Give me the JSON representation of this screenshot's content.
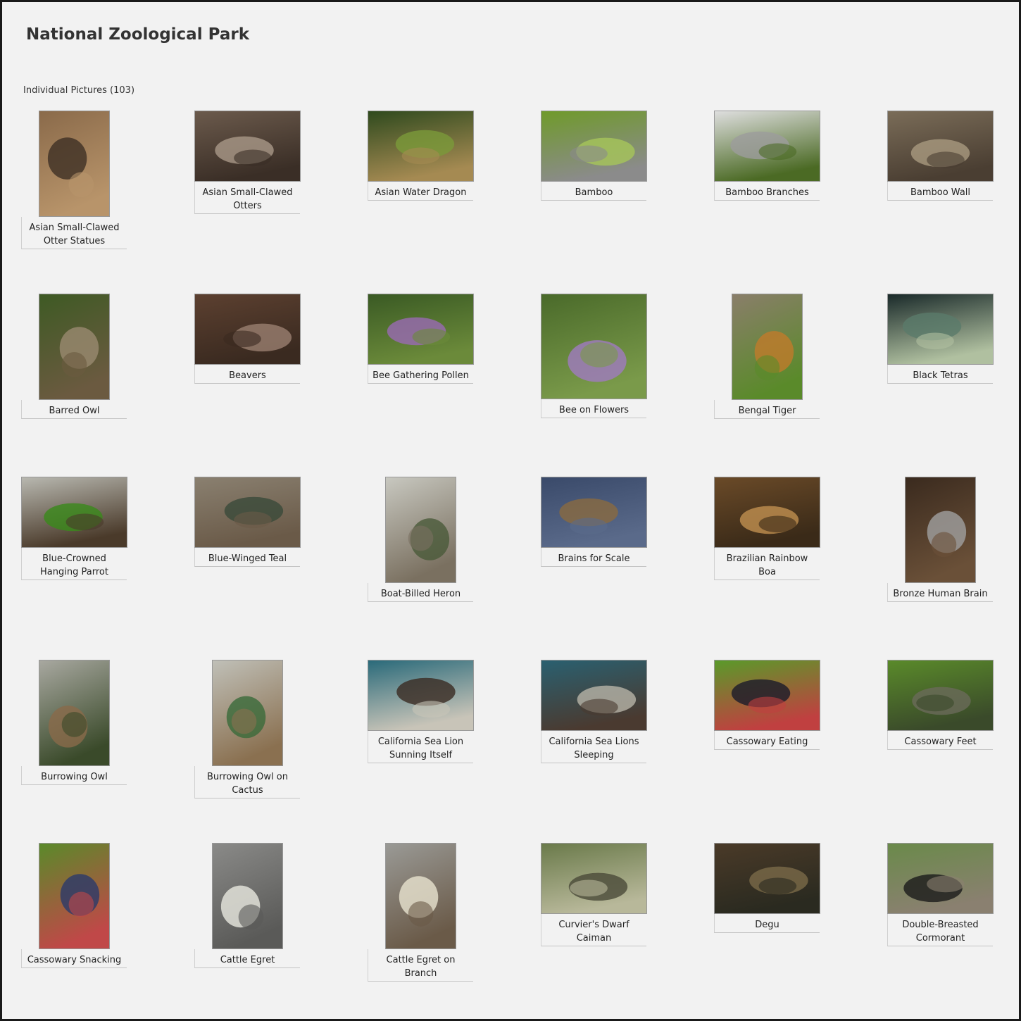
{
  "page": {
    "title": "National Zoological Park"
  },
  "section": {
    "label": "Individual Pictures (103)"
  },
  "photos": [
    {
      "caption": "Asian Small-Clawed Otter Statues",
      "orientation": "portrait",
      "palette": [
        "#8a6a4a",
        "#3d2f24",
        "#b8946a"
      ]
    },
    {
      "caption": "Asian Small-Clawed Otters",
      "orientation": "landscape",
      "palette": [
        "#6b5a4c",
        "#a99888",
        "#3a2e26"
      ]
    },
    {
      "caption": "Asian Water Dragon",
      "orientation": "landscape",
      "palette": [
        "#2f4a1e",
        "#7a9a3a",
        "#a58a52"
      ]
    },
    {
      "caption": "Bamboo",
      "orientation": "landscape",
      "palette": [
        "#6f9a2a",
        "#a6c65a",
        "#8b8b8b"
      ]
    },
    {
      "caption": "Bamboo Branches",
      "orientation": "landscape",
      "palette": [
        "#dedede",
        "#9c9c9c",
        "#4b6a24"
      ]
    },
    {
      "caption": "Bamboo Wall",
      "orientation": "landscape",
      "palette": [
        "#7a6c58",
        "#a99a80",
        "#4a3e32"
      ]
    },
    {
      "caption": "Barred Owl",
      "orientation": "portrait",
      "palette": [
        "#3e5a24",
        "#9a8a70",
        "#6b5a40"
      ]
    },
    {
      "caption": "Beavers",
      "orientation": "landscape",
      "palette": [
        "#5c4030",
        "#9a8070",
        "#3a2a20"
      ]
    },
    {
      "caption": "Bee Gathering Pollen",
      "orientation": "landscape",
      "palette": [
        "#3a5a24",
        "#9a6ab4",
        "#6b8a3a"
      ]
    },
    {
      "caption": "Bee on Flowers",
      "orientation": "portrait-wide",
      "palette": [
        "#4a6a2a",
        "#a07ac0",
        "#7a9a4a"
      ]
    },
    {
      "caption": "Bengal Tiger",
      "orientation": "portrait",
      "palette": [
        "#8a7e6a",
        "#c07a2a",
        "#5a8a2a"
      ]
    },
    {
      "caption": "Black Tetras",
      "orientation": "landscape",
      "palette": [
        "#1a2a2a",
        "#5a7a6a",
        "#b0c0a0"
      ]
    },
    {
      "caption": "Blue-Crowned Hanging Parrot",
      "orientation": "landscape",
      "palette": [
        "#b8b8b0",
        "#3a8a1a",
        "#4a3a2a"
      ]
    },
    {
      "caption": "Blue-Winged Teal",
      "orientation": "landscape",
      "palette": [
        "#8a8070",
        "#3a4a3a",
        "#6a5a48"
      ]
    },
    {
      "caption": "Boat-Billed Heron",
      "orientation": "portrait",
      "palette": [
        "#c8c8c0",
        "#4a5a3a",
        "#7a7060"
      ]
    },
    {
      "caption": "Brains for Scale",
      "orientation": "landscape",
      "palette": [
        "#3a4a6a",
        "#8a6a40",
        "#5a6a8a"
      ]
    },
    {
      "caption": "Brazilian Rainbow Boa",
      "orientation": "landscape",
      "palette": [
        "#6a4a28",
        "#c09050",
        "#3a2a18"
      ]
    },
    {
      "caption": "Bronze Human Brain",
      "orientation": "portrait",
      "palette": [
        "#3a2a1e",
        "#a0a0a0",
        "#6a5038"
      ]
    },
    {
      "caption": "Burrowing Owl",
      "orientation": "portrait",
      "palette": [
        "#a8a8a0",
        "#8a6a4a",
        "#3a4a2a"
      ]
    },
    {
      "caption": "Burrowing Owl on Cactus",
      "orientation": "portrait",
      "palette": [
        "#c0c0b8",
        "#3a6a3a",
        "#8a7050"
      ]
    },
    {
      "caption": "California Sea Lion Sunning Itself",
      "orientation": "landscape",
      "palette": [
        "#2a6a7a",
        "#3a2a22",
        "#c8c4b8"
      ]
    },
    {
      "caption": "California Sea Lions Sleeping",
      "orientation": "landscape",
      "palette": [
        "#2a6070",
        "#b8b4a8",
        "#4a3a30"
      ]
    },
    {
      "caption": "Cassowary Eating",
      "orientation": "landscape",
      "palette": [
        "#5a9a2a",
        "#1a1a2a",
        "#c04040"
      ]
    },
    {
      "caption": "Cassowary Feet",
      "orientation": "landscape",
      "palette": [
        "#5a8a2a",
        "#6a6a5a",
        "#3a4a2a"
      ]
    },
    {
      "caption": "Cassowary Snacking",
      "orientation": "portrait",
      "palette": [
        "#5a8a2a",
        "#2a3a6a",
        "#c04848"
      ]
    },
    {
      "caption": "Cattle Egret",
      "orientation": "portrait",
      "palette": [
        "#8a8a88",
        "#e8e8e0",
        "#5a5a58"
      ]
    },
    {
      "caption": "Cattle Egret on Branch",
      "orientation": "portrait",
      "palette": [
        "#9a9a96",
        "#e8e4d0",
        "#6a5a48"
      ]
    },
    {
      "caption": "Curvier's Dwarf Caiman",
      "orientation": "landscape",
      "palette": [
        "#6a7a4a",
        "#4a4a38",
        "#b8b89a"
      ]
    },
    {
      "caption": "Degu",
      "orientation": "landscape",
      "palette": [
        "#4a3a28",
        "#7a6a48",
        "#2a2a20"
      ]
    },
    {
      "caption": "Double-Breasted Cormorant",
      "orientation": "landscape",
      "palette": [
        "#6a8a4a",
        "#1a1a1a",
        "#8a8070"
      ]
    }
  ]
}
